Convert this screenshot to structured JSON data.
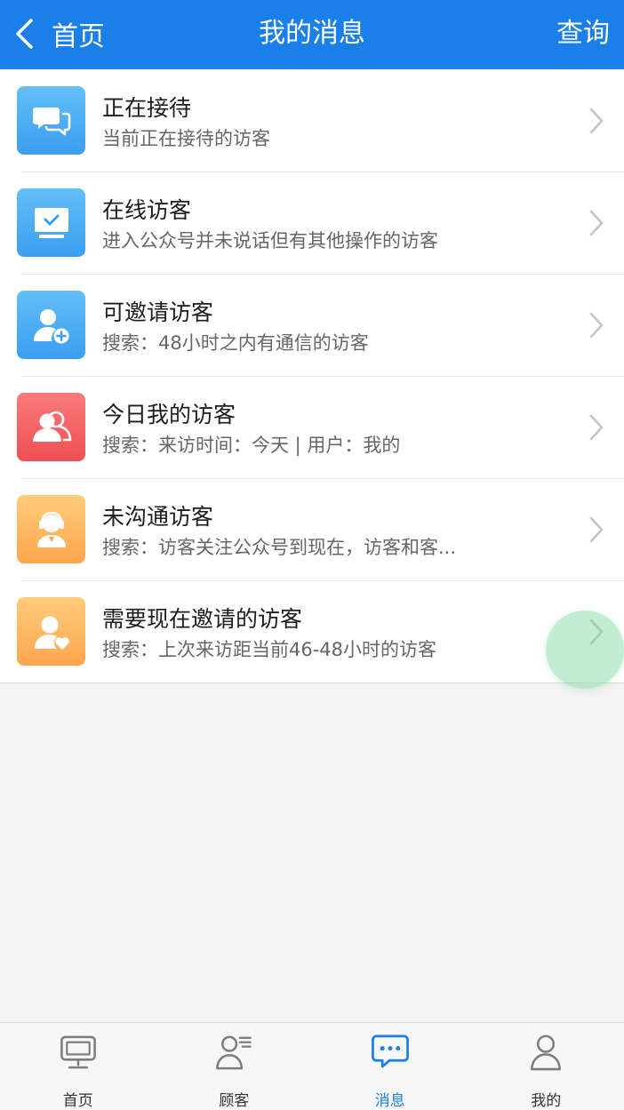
{
  "header": {
    "back_label": "首页",
    "title": "我的消息",
    "action_label": "查询"
  },
  "colors": {
    "header_bg": "#1a7fe8",
    "tab_active": "#1a7fe8",
    "tile_blue": "#3b9ef0",
    "tile_red": "#ee4f53",
    "tile_orange": "#fda64c"
  },
  "items": [
    {
      "title": "正在接待",
      "subtitle": "当前正在接待的访客",
      "icon": "chat-bubbles-icon"
    },
    {
      "title": "在线访客",
      "subtitle": "进入公众号并未说话但有其他操作的访客",
      "icon": "monitor-check-icon"
    },
    {
      "title": "可邀请访客",
      "subtitle": "搜索：48小时之内有通信的访客",
      "icon": "user-add-icon"
    },
    {
      "title": "今日我的访客",
      "subtitle": "搜索：来访时间：今天 | 用户：我的",
      "icon": "users-icon"
    },
    {
      "title": "未沟通访客",
      "subtitle": "搜索：访客关注公众号到现在，访客和客...",
      "icon": "user-service-icon"
    },
    {
      "title": "需要现在邀请的访客",
      "subtitle": "搜索：上次来访距当前46-48小时的访客",
      "icon": "user-heart-icon"
    }
  ],
  "tabs": [
    {
      "label": "首页",
      "icon": "monitor-icon",
      "active": false
    },
    {
      "label": "顾客",
      "icon": "customer-icon",
      "active": false
    },
    {
      "label": "消息",
      "icon": "message-icon",
      "active": true
    },
    {
      "label": "我的",
      "icon": "person-icon",
      "active": false
    }
  ]
}
